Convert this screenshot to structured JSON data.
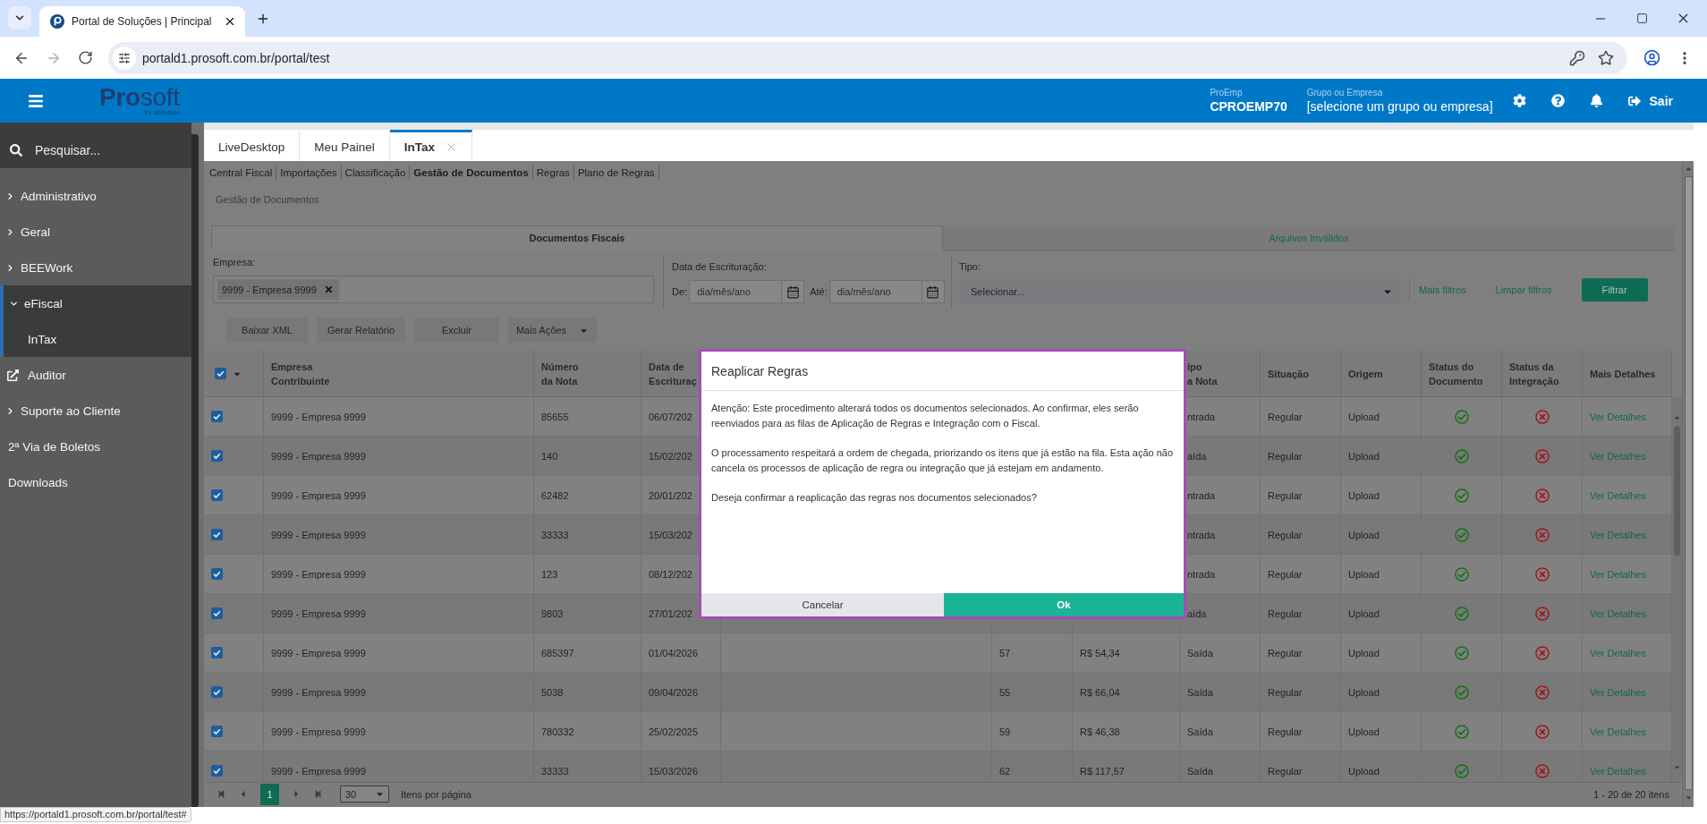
{
  "browser": {
    "tab_title": "Portal de Soluções | Principal",
    "url": "portald1.prosoft.com.br/portal/test",
    "status_url": "https://portald1.prosoft.com.br/portal/test#"
  },
  "header": {
    "logo": "**Pro**soft",
    "logo_tagline": "by alterdata",
    "proemp_label": "ProEmp",
    "proemp_value": "CPROEMP70",
    "group_label": "Grupo ou Empresa",
    "group_value": "[selecione um grupo ou empresa]",
    "logout": "Sair"
  },
  "sidebar": {
    "search": {
      "placeholder": "Pesquisar..."
    },
    "items": [
      {
        "label": "Administrativo",
        "kind": "group",
        "expanded": false,
        "selected": false
      },
      {
        "label": "Geral",
        "kind": "group",
        "expanded": false,
        "selected": false
      },
      {
        "label": "BEEWork",
        "kind": "group",
        "expanded": false,
        "selected": false
      },
      {
        "label": "eFiscal",
        "kind": "group",
        "expanded": true,
        "selected": true,
        "children": [
          {
            "label": "InTax"
          }
        ]
      },
      {
        "label": "Auditor",
        "kind": "external",
        "selected": false
      },
      {
        "label": "Suporte ao Cliente",
        "kind": "group",
        "expanded": false,
        "selected": false
      },
      {
        "label": "2ª Via de Boletos",
        "kind": "link",
        "selected": false
      },
      {
        "label": "Downloads",
        "kind": "link",
        "selected": false
      }
    ]
  },
  "app_tabs": [
    {
      "label": "LiveDesktop",
      "selected": false,
      "closable": false
    },
    {
      "label": "Meu Painel",
      "selected": false,
      "closable": false
    },
    {
      "label": "InTax",
      "selected": true,
      "closable": true
    }
  ],
  "subnav": [
    {
      "label": "Central Fiscal",
      "selected": false
    },
    {
      "label": "Importações",
      "selected": false
    },
    {
      "label": "Classificação",
      "selected": false
    },
    {
      "label": "Gestão de Documentos",
      "selected": true
    },
    {
      "label": "Regras",
      "selected": false
    },
    {
      "label": "Plano de Regras",
      "selected": false
    }
  ],
  "breadcrumb": "Gestão de Documentos",
  "doc_tabs": [
    {
      "label": "Documentos Fiscais",
      "selected": true
    },
    {
      "label": "Arquivos Inválidos",
      "selected": false
    }
  ],
  "filters": {
    "company": {
      "label": "Empresa:",
      "tags": [
        "9999 - Empresa 9999"
      ]
    },
    "date": {
      "label": "Data de Escrituração:",
      "from_label": "De:",
      "from": {
        "placeholder": "dia/mês/ano"
      },
      "to_label": "Até:",
      "to": {
        "placeholder": "dia/mês/ano"
      }
    },
    "type": {
      "label": "Tipo:",
      "placeholder": "Selecionar..."
    },
    "links": [
      "Mais filtros",
      "Limpar filtros"
    ],
    "submit": "Filtrar"
  },
  "actions": [
    {
      "label": "Baixar XML",
      "kind": "button"
    },
    {
      "label": "Gerar Relatório",
      "kind": "button"
    },
    {
      "label": "Excluir",
      "kind": "button"
    },
    {
      "label": "Mais Ações",
      "kind": "split"
    }
  ],
  "table": {
    "all_checked": true,
    "columns": [
      "Empresa\nContribuinte",
      "Número\nda Nota",
      "Data de\nEscrituraç",
      null,
      null,
      null,
      "ipo\na Nota",
      "Situação",
      "Origem",
      "Status do\nDocumento",
      "Status da\nIntegração",
      "Mais Detalhes"
    ],
    "rows": [
      {
        "checked": true,
        "company": "9999 - Empresa 9999",
        "number": "85655",
        "date": "06/07/202",
        "type": "ntrada",
        "situation": "Regular",
        "origin": "Upload",
        "document_ok": true,
        "integration_ok": false,
        "details": "Ver Detalhes"
      },
      {
        "checked": true,
        "company": "9999 - Empresa 9999",
        "number": "140",
        "date": "15/02/202",
        "type": "aída",
        "situation": "Regular",
        "origin": "Upload",
        "document_ok": true,
        "integration_ok": false,
        "details": "Ver Detalhes"
      },
      {
        "checked": true,
        "company": "9999 - Empresa 9999",
        "number": "62482",
        "date": "20/01/202",
        "type": "ntrada",
        "situation": "Regular",
        "origin": "Upload",
        "document_ok": true,
        "integration_ok": false,
        "details": "Ver Detalhes"
      },
      {
        "checked": true,
        "company": "9999 - Empresa 9999",
        "number": "33333",
        "date": "15/03/202",
        "type": "ntrada",
        "situation": "Regular",
        "origin": "Upload",
        "document_ok": true,
        "integration_ok": false,
        "details": "Ver Detalhes"
      },
      {
        "checked": true,
        "company": "9999 - Empresa 9999",
        "number": "123",
        "date": "08/12/202",
        "type": "ntrada",
        "situation": "Regular",
        "origin": "Upload",
        "document_ok": true,
        "integration_ok": false,
        "details": "Ver Detalhes"
      },
      {
        "checked": true,
        "company": "9999 - Empresa 9999",
        "number": "9803",
        "date": "27/01/202",
        "type": "aída",
        "situation": "Regular",
        "origin": "Upload",
        "document_ok": true,
        "integration_ok": false,
        "details": "Ver Detalhes"
      },
      {
        "checked": true,
        "company": "9999 - Empresa 9999",
        "number": "685397",
        "date": "01/04/2026",
        "column_5": "57",
        "column_6": "R$ 54,34",
        "type": "Saída",
        "situation": "Regular",
        "origin": "Upload",
        "document_ok": true,
        "integration_ok": false,
        "details": "Ver Detalhes"
      },
      {
        "checked": true,
        "company": "9999 - Empresa 9999",
        "number": "5038",
        "date": "09/04/2026",
        "column_5": "55",
        "column_6": "R$ 66,04",
        "type": "Saída",
        "situation": "Regular",
        "origin": "Upload",
        "document_ok": true,
        "integration_ok": false,
        "details": "Ver Detalhes"
      },
      {
        "checked": true,
        "company": "9999 - Empresa 9999",
        "number": "780332",
        "date": "25/02/2025",
        "column_5": "59",
        "column_6": "R$ 46,38",
        "type": "Saída",
        "situation": "Regular",
        "origin": "Upload",
        "document_ok": true,
        "integration_ok": false,
        "details": "Ver Detalhes"
      },
      {
        "checked": true,
        "company": "9999 - Empresa 9999",
        "number": "33333",
        "date": "15/03/2026",
        "column_5": "62",
        "column_6": "R$ 117,57",
        "type": "Saída",
        "situation": "Regular",
        "origin": "Upload",
        "document_ok": true,
        "integration_ok": false,
        "details": "Ver Detalhes"
      }
    ]
  },
  "pagination": {
    "pages": [
      {
        "label": "1",
        "selected": true
      }
    ],
    "page_size": "30",
    "page_size_label": "Itens por página",
    "summary": "1 - 20 de 20 itens"
  },
  "dialog": {
    "title": "Reaplicar Regras",
    "paragraphs": [
      "Atenção: Este procedimento alterará todos os documentos selecionados. Ao confirmar, eles serão reenviados para as filas de Aplicação de Regras e Integração com o Fiscal.",
      "O processamento respeitará a ordem de chegada, priorizando os itens que já estão na fila. Esta ação não cancela os processos de aplicação de regra ou integração que já estejam em andamento.",
      "Deseja confirmar a reaplicação das regras nos documentos selecionados?"
    ],
    "cancel": "Cancelar",
    "confirm": "Ok"
  }
}
